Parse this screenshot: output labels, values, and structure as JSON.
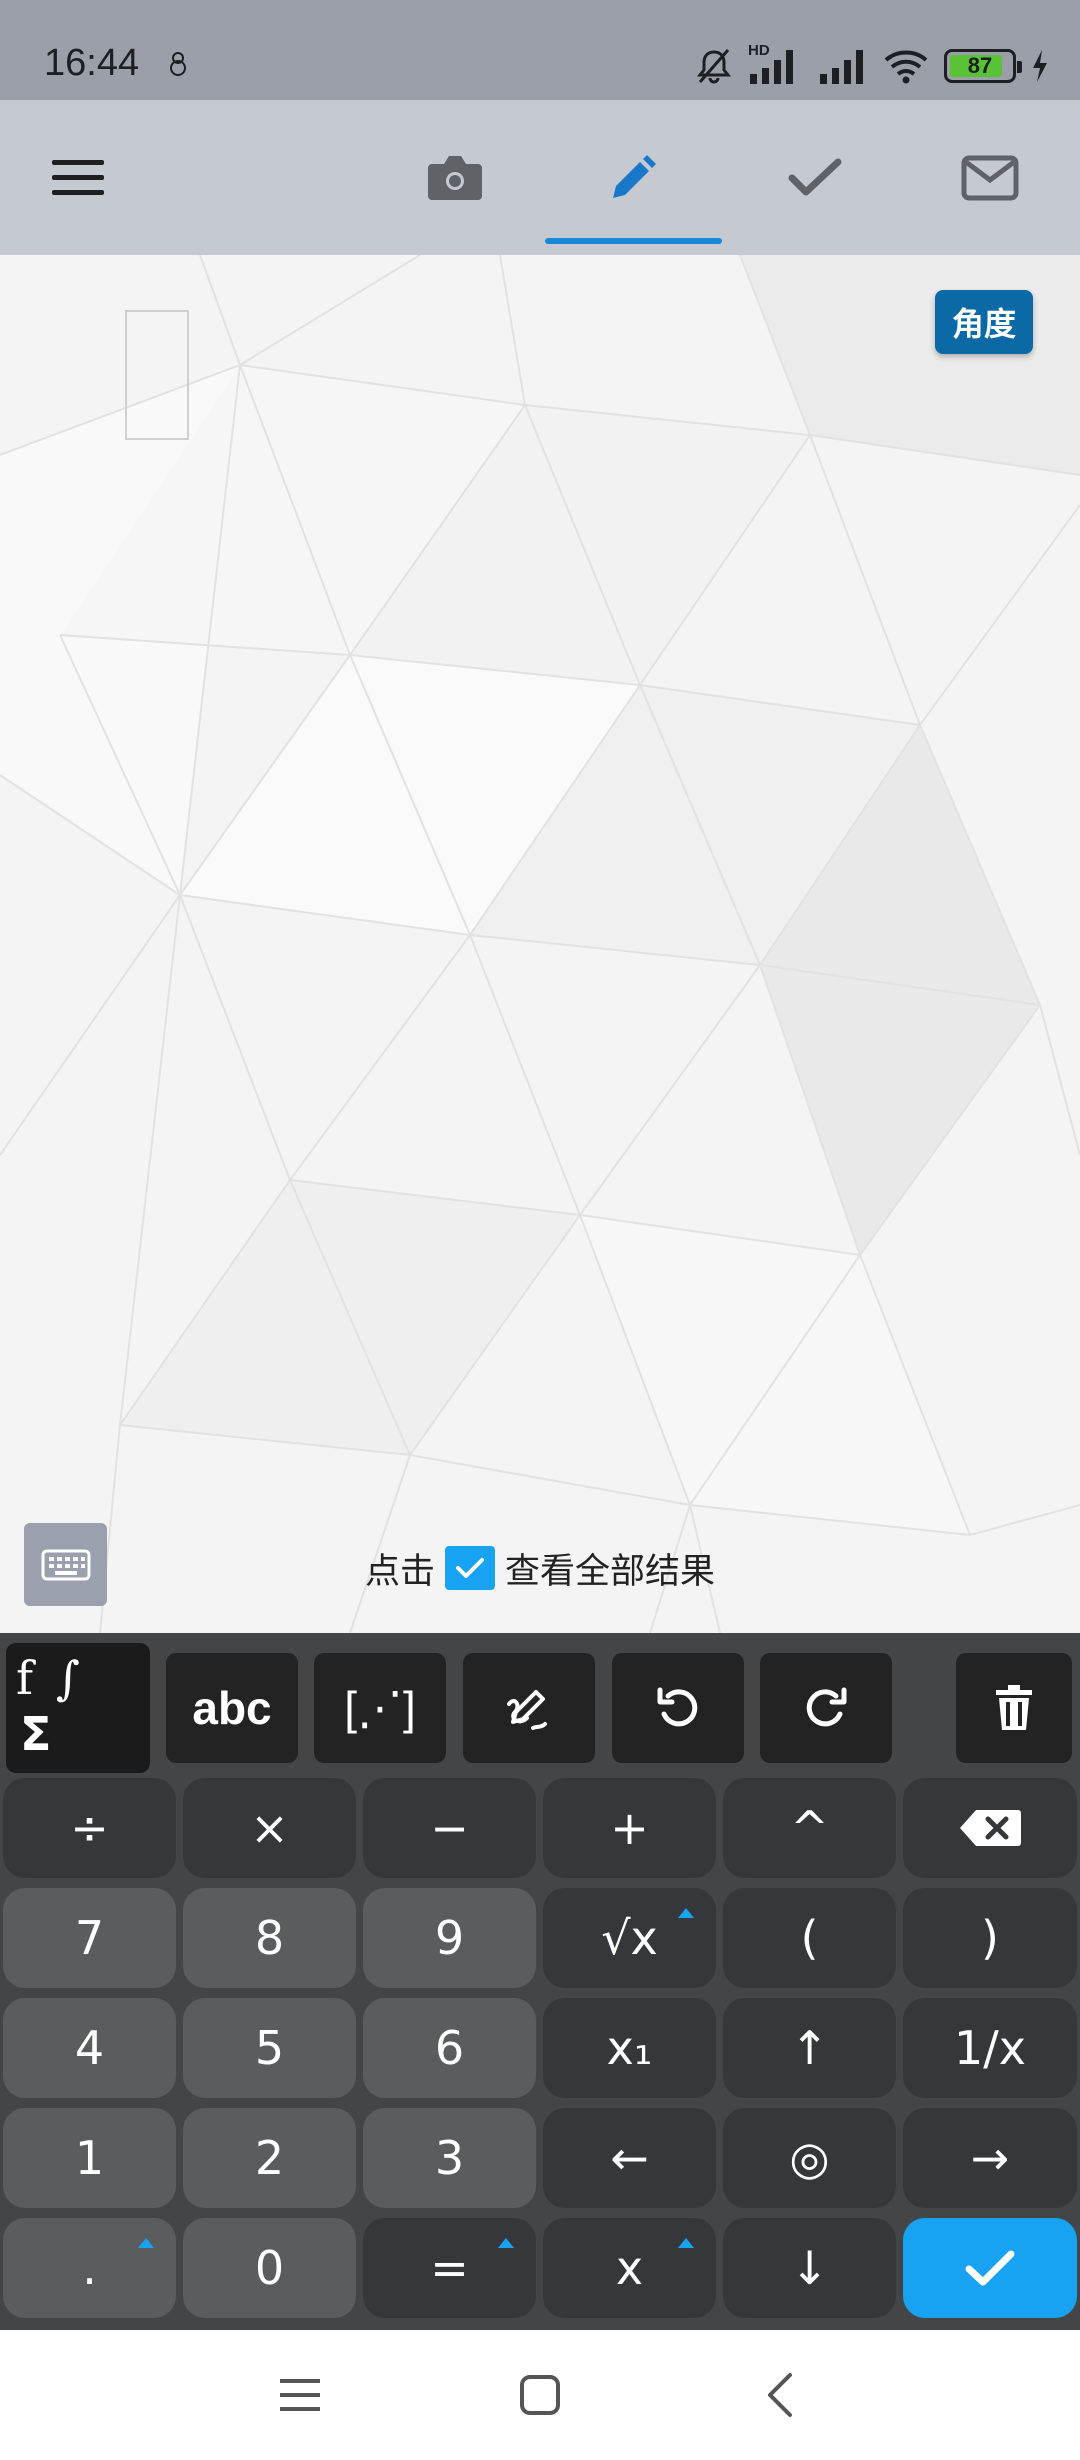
{
  "status": {
    "time": "16:44",
    "battery": "87",
    "battery_level": 0.87,
    "network_tag": "HD"
  },
  "toolbar": {
    "active_tab": "pencil",
    "icons": [
      "menu-icon",
      "camera-icon",
      "pencil-icon",
      "check-icon",
      "mail-icon"
    ],
    "accent": "#1a88d8"
  },
  "canvas": {
    "angle_button": "角度",
    "hint_before": "点击",
    "hint_after": "查看全部结果"
  },
  "keyboard": {
    "function_row": {
      "math": {
        "f": "f",
        "integral": "∫",
        "sigma": "Σ"
      },
      "abc": "abc",
      "matrix": "[⋰]",
      "handwriting": "handwriting-icon",
      "undo": "undo-icon",
      "redo": "redo-icon",
      "delete": "trash-icon"
    },
    "rows": [
      [
        {
          "id": "divide",
          "label": "÷",
          "style": "op"
        },
        {
          "id": "multiply",
          "label": "×",
          "style": "op"
        },
        {
          "id": "minus",
          "label": "−",
          "style": "op"
        },
        {
          "id": "plus",
          "label": "+",
          "style": "op"
        },
        {
          "id": "power",
          "label": "^",
          "style": "op"
        },
        {
          "id": "backspace",
          "label": "",
          "style": "op",
          "icon": "backspace-icon"
        }
      ],
      [
        {
          "id": "7",
          "label": "7",
          "style": "num"
        },
        {
          "id": "8",
          "label": "8",
          "style": "num"
        },
        {
          "id": "9",
          "label": "9",
          "style": "num"
        },
        {
          "id": "sqrt",
          "label": "√x",
          "style": "op",
          "more": true
        },
        {
          "id": "lparen",
          "label": "(",
          "style": "op"
        },
        {
          "id": "rparen",
          "label": ")",
          "style": "op"
        }
      ],
      [
        {
          "id": "4",
          "label": "4",
          "style": "num"
        },
        {
          "id": "5",
          "label": "5",
          "style": "num"
        },
        {
          "id": "6",
          "label": "6",
          "style": "num"
        },
        {
          "id": "subscript",
          "label": "x₁",
          "style": "op"
        },
        {
          "id": "up",
          "label": "↑",
          "style": "op"
        },
        {
          "id": "reciprocal",
          "label": "1/x",
          "style": "op"
        }
      ],
      [
        {
          "id": "1",
          "label": "1",
          "style": "num"
        },
        {
          "id": "2",
          "label": "2",
          "style": "num"
        },
        {
          "id": "3",
          "label": "3",
          "style": "num"
        },
        {
          "id": "left",
          "label": "←",
          "style": "op"
        },
        {
          "id": "center",
          "label": "◎",
          "style": "op"
        },
        {
          "id": "right",
          "label": "→",
          "style": "op"
        }
      ],
      [
        {
          "id": "dot",
          "label": ".",
          "style": "num",
          "more": true
        },
        {
          "id": "0",
          "label": "0",
          "style": "num"
        },
        {
          "id": "equals",
          "label": "=",
          "style": "op",
          "more": true
        },
        {
          "id": "x",
          "label": "x",
          "style": "op",
          "more": true
        },
        {
          "id": "down",
          "label": "↓",
          "style": "op"
        },
        {
          "id": "confirm",
          "label": "",
          "style": "ok",
          "icon": "check-icon"
        }
      ]
    ]
  },
  "navbar": {
    "icons": [
      "recent-apps-icon",
      "home-icon",
      "back-icon"
    ]
  }
}
